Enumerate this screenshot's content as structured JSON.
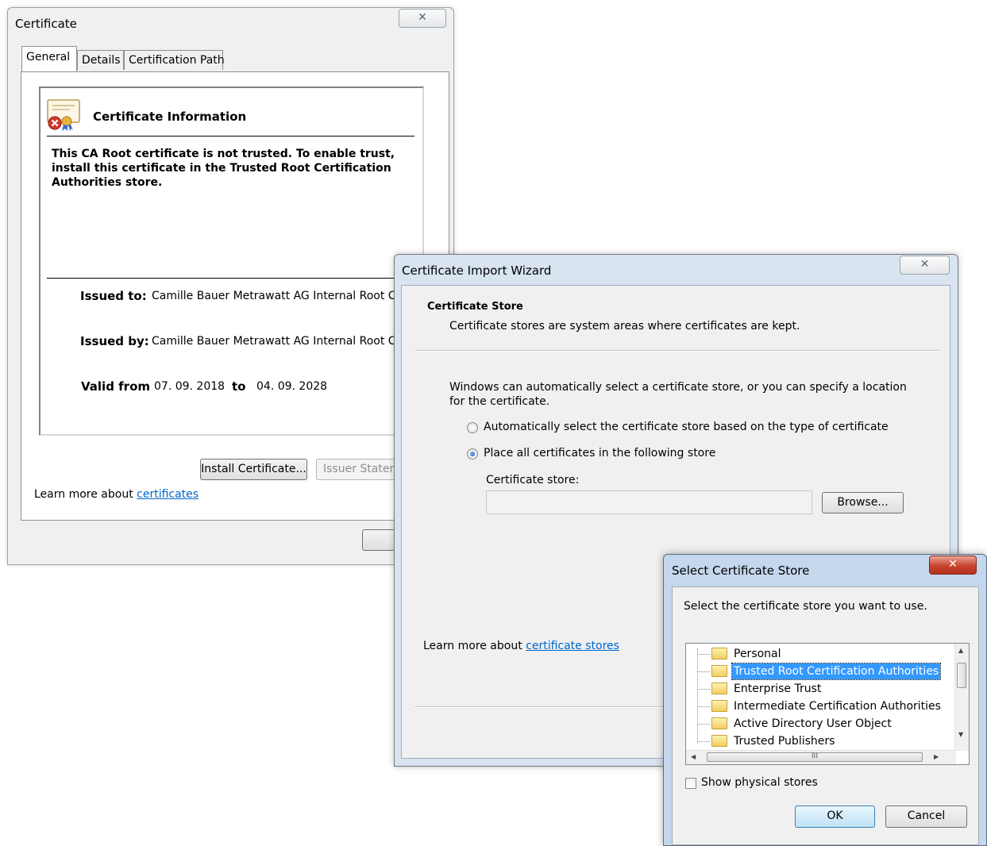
{
  "certificate": {
    "title": "Certificate",
    "close_glyph": "✕",
    "tabs": [
      {
        "label": "General",
        "active": true
      },
      {
        "label": "Details",
        "active": false
      },
      {
        "label": "Certification Path",
        "active": false
      }
    ],
    "info_heading": "Certificate Information",
    "warning": "This CA Root certificate is not trusted. To enable trust, install this certificate in the Trusted Root Certification Authorities store.",
    "issued_to_label": "Issued to:",
    "issued_to_value": "Camille Bauer Metrawatt AG Internal Root CA",
    "issued_by_label": "Issued by:",
    "issued_by_value": "Camille Bauer Metrawatt AG Internal Root CA",
    "valid_from_label": "Valid from",
    "valid_from_value": "07. 09. 2018",
    "valid_to_label": "to",
    "valid_to_value": "04. 09. 2028",
    "install_button": "Install Certificate...",
    "issuer_statement_button": "Issuer Statem",
    "learn_more_prefix": "Learn more about",
    "learn_more_link": "certificates",
    "icons": {
      "certificate": "certificate-error-icon"
    }
  },
  "wizard": {
    "title": "Certificate Import Wizard",
    "close_glyph": "✕",
    "section_title": "Certificate Store",
    "section_subtitle": "Certificate stores are system areas where certificates are kept.",
    "description": "Windows can automatically select a certificate store, or you can specify a location for the certificate.",
    "option_auto": "Automatically select the certificate store based on the type of certificate",
    "option_manual": "Place all certificates in the following store",
    "selected_option": "manual",
    "store_label": "Certificate store:",
    "store_value": "",
    "browse_button": "Browse...",
    "learn_more_prefix": "Learn more about",
    "learn_more_link": "certificate stores"
  },
  "select_store": {
    "title": "Select Certificate Store",
    "close_glyph": "✕",
    "prompt": "Select the certificate store you want to use.",
    "stores": [
      {
        "label": "Personal",
        "selected": false
      },
      {
        "label": "Trusted Root Certification Authorities",
        "selected": true
      },
      {
        "label": "Enterprise Trust",
        "selected": false
      },
      {
        "label": "Intermediate Certification Authorities",
        "selected": false
      },
      {
        "label": "Active Directory User Object",
        "selected": false
      },
      {
        "label": "Trusted Publishers",
        "selected": false
      }
    ],
    "scroll_thumb_glyph": "III",
    "show_physical_label": "Show physical stores",
    "show_physical_checked": false,
    "ok_button": "OK",
    "cancel_button": "Cancel"
  },
  "colors": {
    "link": "#0066cc",
    "selection": "#3399ff",
    "close_red": "#c8422d",
    "wizard_frame": "#d9e4f1"
  }
}
